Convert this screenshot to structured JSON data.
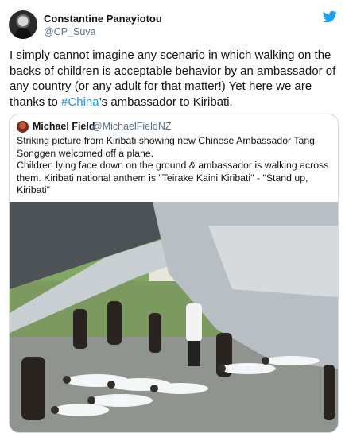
{
  "author": {
    "name": "Constantine Panayiotou",
    "handle": "@CP_Suva"
  },
  "icons": {
    "brand": "twitter-bird-icon",
    "author_avatar": "avatar",
    "quote_avatar": "avatar"
  },
  "colors": {
    "link": "#1b95e0",
    "brand": "#1da1f2",
    "secondary_text": "#5b7083"
  },
  "tweet": {
    "text_before": "I simply cannot imagine any scenario in which walking on the backs of children is acceptable behavior by an ambassador of any country (or any adult for that matter!) Yet here we are thanks to ",
    "hashtag": "#China",
    "text_after": "’s ambassador to Kiribati."
  },
  "quoted": {
    "name": "Michael Field",
    "handle": "@MichaelFieldNZ",
    "line1": "Striking picture from Kiribati showing new Chinese Ambassador Tang Songgen welcomed off a plane.",
    "line2": "Children lying face down on the ground & ambassador is walking across them. Kiribati national anthem is \"Teirake Kaini Kiribati\" - \"Stand up, Kiribati\""
  }
}
